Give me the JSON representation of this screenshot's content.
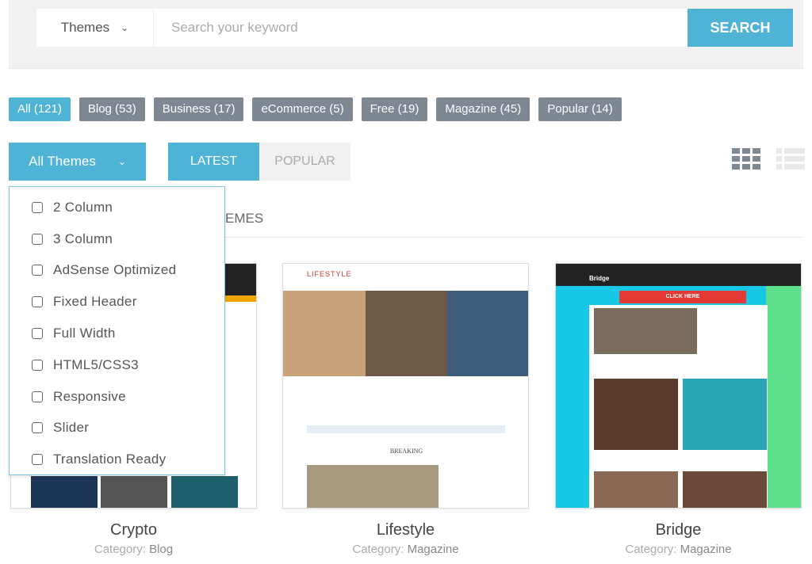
{
  "search": {
    "scope": "Themes",
    "placeholder": "Search your keyword",
    "button": "SEARCH"
  },
  "categories": [
    "All (121)",
    "Blog (53)",
    "Business (17)",
    "eCommerce (5)",
    "Free (19)",
    "Magazine (45)",
    "Popular (14)"
  ],
  "filter": {
    "label": "All Themes",
    "options": [
      "2 Column",
      "3 Column",
      "AdSense Optimized",
      "Fixed Header",
      "Full Width",
      "HTML5/CSS3",
      "Responsive",
      "Slider",
      "Translation Ready"
    ]
  },
  "sort": {
    "latest": "LATEST",
    "popular": "POPULAR"
  },
  "section_heading": "EMES",
  "cards": [
    {
      "title": "Crypto",
      "category_label": "Category:",
      "category": "Blog"
    },
    {
      "title": "Lifestyle",
      "category_label": "Category:",
      "category": "Magazine",
      "thumb_logo": "LIFESTYLE",
      "thumb_text": "BREAKING"
    },
    {
      "title": "Bridge",
      "category_label": "Category:",
      "category": "Magazine",
      "thumb_logo": "Bridge",
      "thumb_button": "CLICK HERE"
    }
  ],
  "colors": {
    "accent": "#4fb3d6",
    "tag": "#7e8892"
  }
}
